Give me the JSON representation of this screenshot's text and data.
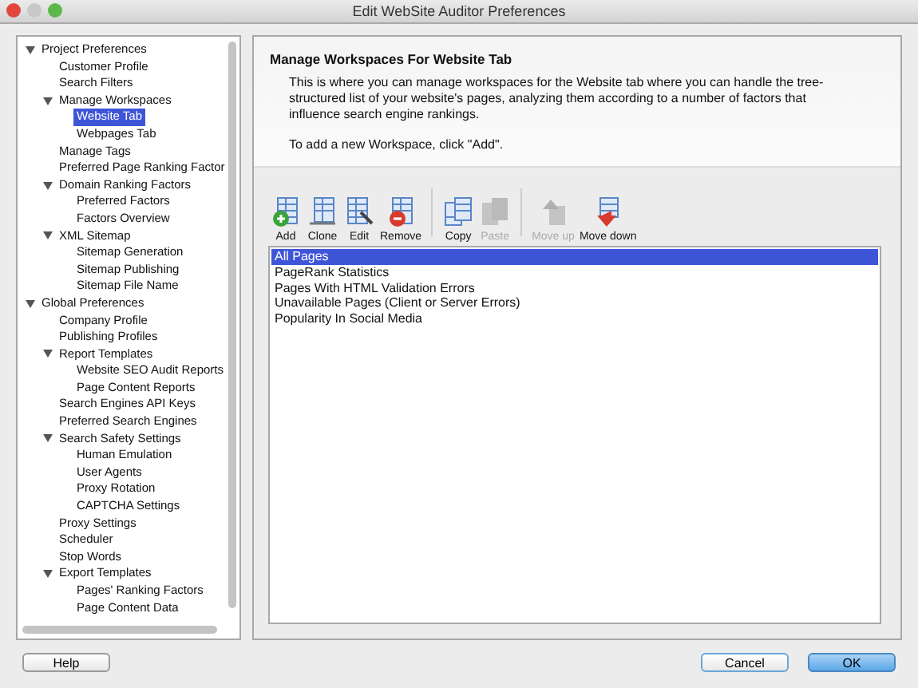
{
  "window": {
    "title": "Edit WebSite Auditor Preferences"
  },
  "tree": [
    {
      "label": "Project Preferences",
      "selected": false,
      "expanded": true,
      "children": [
        {
          "label": "Customer Profile",
          "selected": false
        },
        {
          "label": "Search Filters",
          "selected": false
        },
        {
          "label": "Manage Workspaces",
          "selected": false,
          "expanded": true,
          "children": [
            {
              "label": "Website Tab",
              "selected": true
            },
            {
              "label": "Webpages Tab",
              "selected": false
            }
          ]
        },
        {
          "label": "Manage Tags",
          "selected": false
        },
        {
          "label": "Preferred Page Ranking Factor",
          "selected": false
        },
        {
          "label": "Domain Ranking Factors",
          "selected": false,
          "expanded": true,
          "children": [
            {
              "label": "Preferred Factors",
              "selected": false
            },
            {
              "label": "Factors Overview",
              "selected": false
            }
          ]
        },
        {
          "label": "XML Sitemap",
          "selected": false,
          "expanded": true,
          "children": [
            {
              "label": "Sitemap Generation",
              "selected": false
            },
            {
              "label": "Sitemap Publishing",
              "selected": false
            },
            {
              "label": "Sitemap File Name",
              "selected": false
            }
          ]
        }
      ]
    },
    {
      "label": "Global Preferences",
      "selected": false,
      "expanded": true,
      "children": [
        {
          "label": "Company Profile",
          "selected": false
        },
        {
          "label": "Publishing Profiles",
          "selected": false
        },
        {
          "label": "Report Templates",
          "selected": false,
          "expanded": true,
          "children": [
            {
              "label": "Website SEO Audit Reports",
              "selected": false
            },
            {
              "label": "Page Content Reports",
              "selected": false
            }
          ]
        },
        {
          "label": "Search Engines API Keys",
          "selected": false
        },
        {
          "label": "Preferred Search Engines",
          "selected": false
        },
        {
          "label": "Search Safety Settings",
          "selected": false,
          "expanded": true,
          "children": [
            {
              "label": "Human Emulation",
              "selected": false
            },
            {
              "label": "User Agents",
              "selected": false
            },
            {
              "label": "Proxy Rotation",
              "selected": false
            },
            {
              "label": "CAPTCHA Settings",
              "selected": false
            }
          ]
        },
        {
          "label": "Proxy Settings",
          "selected": false
        },
        {
          "label": "Scheduler",
          "selected": false
        },
        {
          "label": "Stop Words",
          "selected": false
        },
        {
          "label": "Export Templates",
          "selected": false,
          "expanded": true,
          "children": [
            {
              "label": "Pages' Ranking Factors",
              "selected": false
            },
            {
              "label": "Page Content Data",
              "selected": false
            }
          ]
        }
      ]
    }
  ],
  "panel": {
    "title": "Manage Workspaces For Website Tab",
    "paragraphs": [
      "This is where you can manage workspaces for the Website tab where you can handle the tree-structured list of your website's pages, analyzing them according to a number of factors that influence search engine rankings.",
      "To add a new Workspace, click \"Add\"."
    ]
  },
  "toolbar": [
    [
      {
        "kind": "add",
        "label": "Add",
        "disabled": false
      },
      {
        "kind": "clone",
        "label": "Clone",
        "disabled": false
      },
      {
        "kind": "edit",
        "label": "Edit",
        "disabled": false
      },
      {
        "kind": "remove",
        "label": "Remove",
        "disabled": false
      }
    ],
    [
      {
        "kind": "copy",
        "label": "Copy",
        "disabled": false
      },
      {
        "kind": "paste",
        "label": "Paste",
        "disabled": true
      }
    ],
    [
      {
        "kind": "up",
        "label": "Move up",
        "disabled": true
      },
      {
        "kind": "down",
        "label": "Move down",
        "disabled": false
      }
    ]
  ],
  "workspaces": [
    {
      "label": "All Pages",
      "selected": true
    },
    {
      "label": "PageRank Statistics",
      "selected": false
    },
    {
      "label": "Pages With HTML Validation Errors",
      "selected": false
    },
    {
      "label": "Unavailable Pages (Client or Server Errors)",
      "selected": false
    },
    {
      "label": "Popularity In Social Media",
      "selected": false
    }
  ],
  "buttons": {
    "help": "Help",
    "cancel": "Cancel",
    "ok": "OK"
  }
}
